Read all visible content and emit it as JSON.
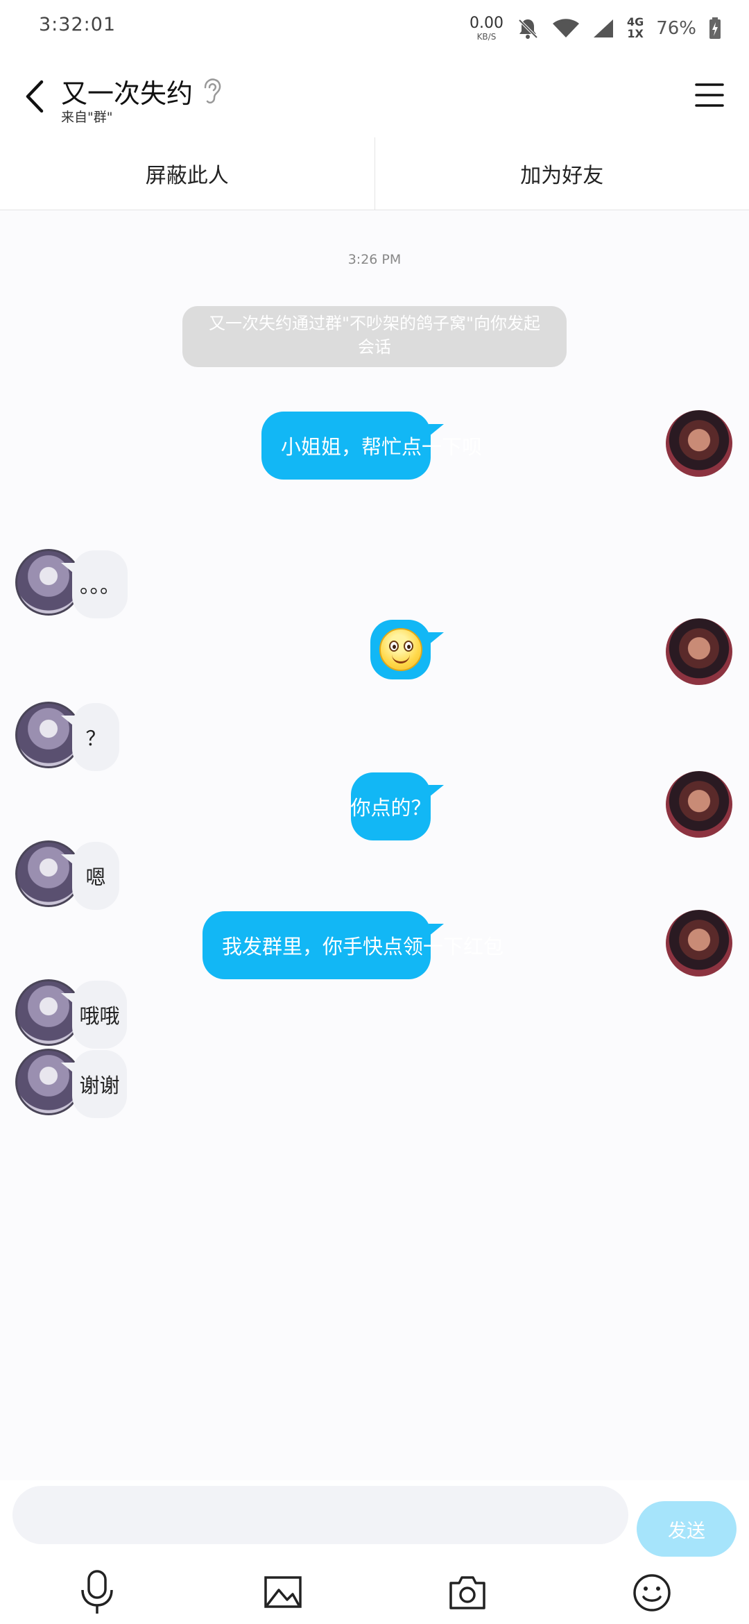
{
  "status_bar": {
    "time": "3:32:01",
    "net_speed_value": "0.00",
    "net_speed_unit": "KB/S",
    "network_top": "4G",
    "network_bottom": "1X",
    "battery": "76%"
  },
  "header": {
    "title": "又一次失约",
    "subtitle": "来自\"群\""
  },
  "actions": {
    "block": "屏蔽此人",
    "add_friend": "加为好友"
  },
  "chat": {
    "timestamp": "3:26 PM",
    "system_message": "又一次失约通过群\"不吵架的鸽子窝\"向你发起会话",
    "messages": [
      {
        "from": "me",
        "text": "小姐姐，帮忙点一下呗"
      },
      {
        "from": "other",
        "text": "。。。"
      },
      {
        "from": "me",
        "text": "",
        "emoji": "smile-emoji"
      },
      {
        "from": "other",
        "text": "？"
      },
      {
        "from": "me",
        "text": "你点的？"
      },
      {
        "from": "other",
        "text": "嗯"
      },
      {
        "from": "me",
        "text": "我发群里，你手快点领一下红包"
      },
      {
        "from": "other",
        "text": "哦哦"
      },
      {
        "from": "other",
        "text": "谢谢"
      }
    ]
  },
  "input": {
    "value": "",
    "placeholder": "",
    "send_label": "发送"
  },
  "toolbar_icons": [
    "microphone-icon",
    "image-icon",
    "camera-icon",
    "emoji-icon"
  ],
  "colors": {
    "outgoing_bubble": "#12b7f5",
    "incoming_bubble": "#f0f1f5",
    "send_button_disabled": "#a6e4fb"
  }
}
